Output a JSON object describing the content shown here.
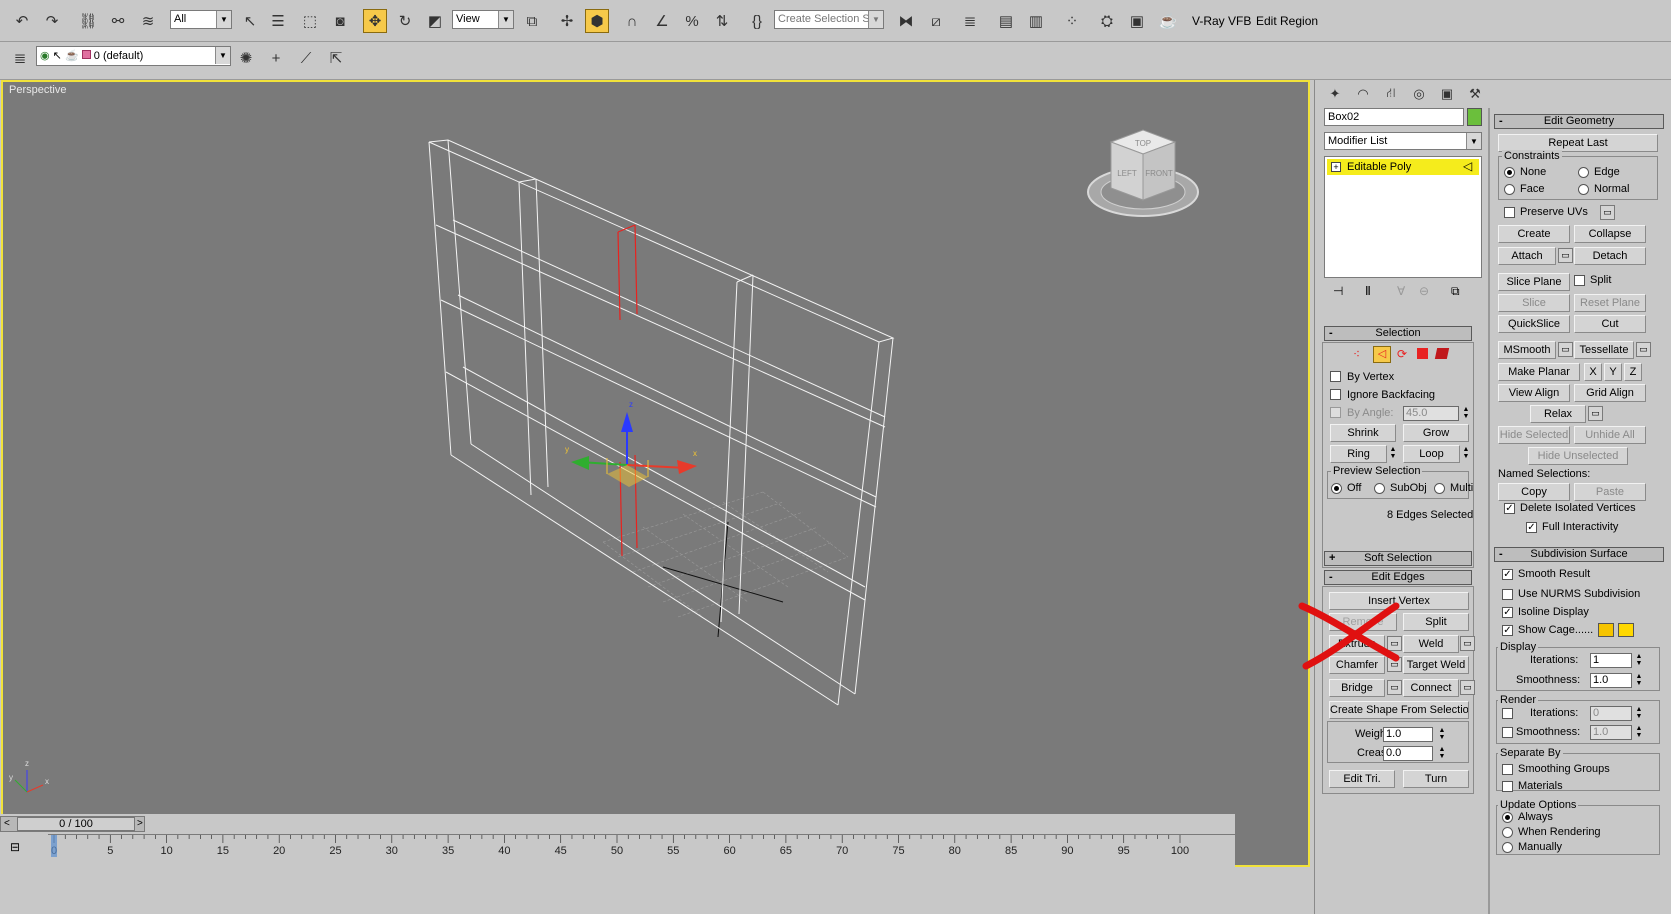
{
  "toolbar": {
    "selection_filter": "All",
    "ref_coord": "View",
    "named_selection_placeholder": "Create Selection Se",
    "vray_label": "V-Ray VFB",
    "edit_region_label": "Edit Region",
    "icons": [
      "undo-icon",
      "redo-icon",
      "select-link-icon",
      "unlink-icon",
      "bind-space-warp-icon",
      "select-object-icon",
      "select-by-name-icon",
      "rect-selection-icon",
      "window-crossing-icon",
      "move-icon",
      "rotate-icon",
      "scale-icon",
      "ref-coord-icon",
      "pivot-icon",
      "manipulate-icon",
      "keyboard-shortcut-icon",
      "snap-icon",
      "angle-snap-icon",
      "percent-snap-icon",
      "spinner-snap-icon",
      "edit-named-selection-icon",
      "mirror-icon",
      "align-icon",
      "layer-manager-icon",
      "curve-editor-icon",
      "schematic-view-icon",
      "material-editor-icon",
      "render-setup-icon",
      "rendered-frame-icon",
      "quick-render-icon"
    ],
    "active_icons": [
      "move-icon",
      "keyboard-shortcut-icon"
    ]
  },
  "layer_bar": {
    "layer_name": "0 (default)"
  },
  "viewport": {
    "label": "Perspective",
    "viewcube": {
      "top": "TOP",
      "left": "LEFT",
      "front": "FRONT"
    }
  },
  "command_panel": {
    "object_name": "Box02",
    "object_color": "#6bbf3c",
    "modifier_list": "Modifier List",
    "stack_item": "Editable Poly",
    "selection": {
      "title": "Selection",
      "by_vertex": "By Vertex",
      "ignore_backfacing": "Ignore Backfacing",
      "by_angle": "By Angle:",
      "by_angle_value": "45.0",
      "shrink": "Shrink",
      "grow": "Grow",
      "ring": "Ring",
      "loop": "Loop",
      "preview_title": "Preview Selection",
      "preview_off": "Off",
      "preview_subobj": "SubObj",
      "preview_multi": "Multi",
      "status": "8 Edges Selected"
    },
    "soft_selection": "Soft Selection",
    "edit_edges": {
      "title": "Edit Edges",
      "insert_vertex": "Insert Vertex",
      "remove": "Remove",
      "split": "Split",
      "extrude": "Extrude",
      "weld": "Weld",
      "chamfer": "Chamfer",
      "target_weld": "Target Weld",
      "bridge": "Bridge",
      "connect": "Connect",
      "create_shape": "Create Shape From Selection",
      "weight_label": "Weight:",
      "weight_value": "1.0",
      "crease_label": "Crease:",
      "crease_value": "0.0",
      "edit_tri": "Edit Tri.",
      "turn": "Turn"
    }
  },
  "edit_geometry": {
    "title": "Edit Geometry",
    "repeat_last": "Repeat Last",
    "constraints": "Constraints",
    "none": "None",
    "edge": "Edge",
    "face": "Face",
    "normal": "Normal",
    "preserve_uvs": "Preserve UVs",
    "create": "Create",
    "collapse": "Collapse",
    "attach": "Attach",
    "detach": "Detach",
    "slice_plane": "Slice Plane",
    "split": "Split",
    "slice": "Slice",
    "reset_plane": "Reset Plane",
    "quickslice": "QuickSlice",
    "cut": "Cut",
    "msmooth": "MSmooth",
    "tessellate": "Tessellate",
    "make_planar": "Make Planar",
    "x": "X",
    "y": "Y",
    "z": "Z",
    "view_align": "View Align",
    "grid_align": "Grid Align",
    "relax": "Relax",
    "hide_selected": "Hide Selected",
    "unhide_all": "Unhide All",
    "hide_unselected": "Hide Unselected",
    "named_selections": "Named Selections:",
    "copy": "Copy",
    "paste": "Paste",
    "delete_isolated": "Delete Isolated Vertices",
    "full_interactivity": "Full Interactivity"
  },
  "subdivision_surface": {
    "title": "Subdivision Surface",
    "smooth_result": "Smooth Result",
    "use_nurms": "Use NURMS Subdivision",
    "isoline_display": "Isoline Display",
    "show_cage": "Show Cage......",
    "cage_color_1": "#f5c400",
    "cage_color_2": "#ffd800",
    "display": "Display",
    "iterations": "Iterations:",
    "iterations_value": "1",
    "smoothness": "Smoothness:",
    "smoothness_value": "1.0",
    "render": "Render",
    "render_iterations_value": "0",
    "render_smoothness_value": "1.0",
    "separate_by": "Separate By",
    "smoothing_groups": "Smoothing Groups",
    "materials": "Materials",
    "update_options": "Update Options",
    "always": "Always",
    "when_rendering": "When Rendering",
    "manually": "Manually"
  },
  "timeline": {
    "frame_counter": "0 / 100",
    "ticks": [
      "0",
      "5",
      "10",
      "15",
      "20",
      "25",
      "30",
      "35",
      "40",
      "45",
      "50",
      "55",
      "60",
      "65",
      "70",
      "75",
      "80",
      "85",
      "90",
      "95",
      "100"
    ]
  }
}
